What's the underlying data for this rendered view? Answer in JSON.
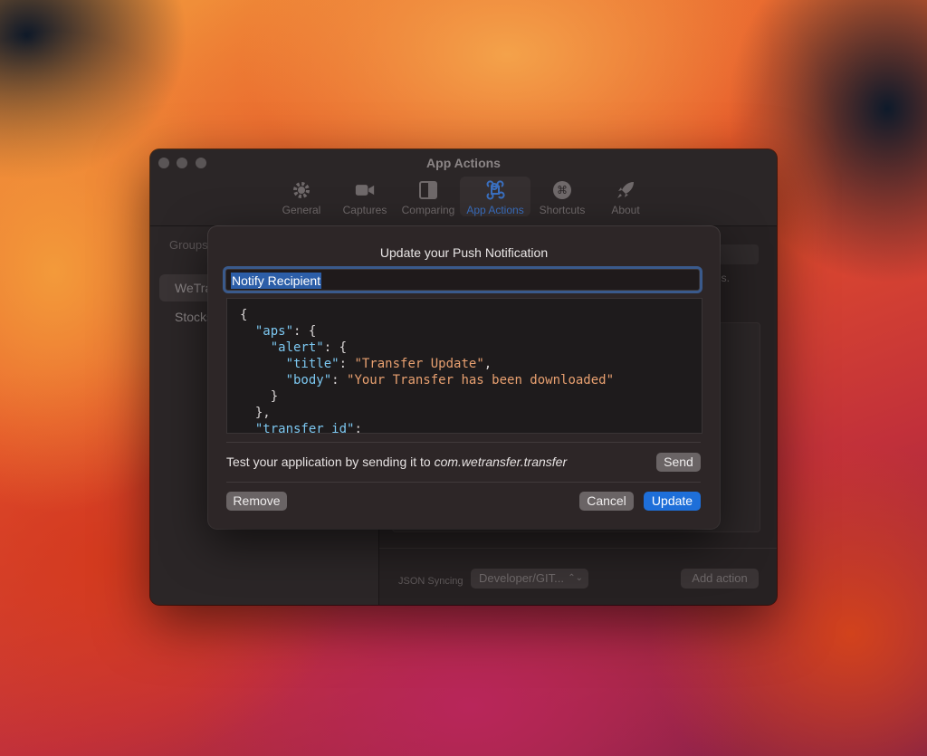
{
  "window": {
    "title": "App Actions",
    "toolbar": [
      {
        "label": "General",
        "icon": "gear-icon"
      },
      {
        "label": "Captures",
        "icon": "video-camera-icon"
      },
      {
        "label": "Comparing",
        "icon": "split-view-icon"
      },
      {
        "label": "App Actions",
        "icon": "command-icon"
      },
      {
        "label": "Shortcuts",
        "icon": "command-circle-icon"
      },
      {
        "label": "About",
        "icon": "rocket-icon"
      }
    ],
    "active_tab": "App Actions"
  },
  "sidebar": {
    "header": "Groups",
    "items": [
      {
        "label": "WeTransfer"
      },
      {
        "label": "Stocks"
      }
    ]
  },
  "main": {
    "snippet": "ds.",
    "json_syncing_label": "JSON Syncing",
    "json_syncing_value": "Developer/GIT...",
    "add_action_label": "Add action"
  },
  "dialog": {
    "title": "Update your Push Notification",
    "name_value": "Notify Recipient",
    "payload_lines": [
      "{",
      "  \"aps\": {",
      "    \"alert\": {",
      "      \"title\": \"Transfer Update\",",
      "      \"body\": \"Your Transfer has been downloaded\"",
      "    }",
      "  },",
      "  \"transfer_id\":"
    ],
    "test_text": "Test your application by sending it to ",
    "bundle_id": "com.wetransfer.transfer",
    "send_label": "Send",
    "remove_label": "Remove",
    "cancel_label": "Cancel",
    "update_label": "Update"
  },
  "colors": {
    "accent": "#1e6fd9",
    "json_key": "#7cc7f0",
    "json_string": "#e8a070"
  }
}
